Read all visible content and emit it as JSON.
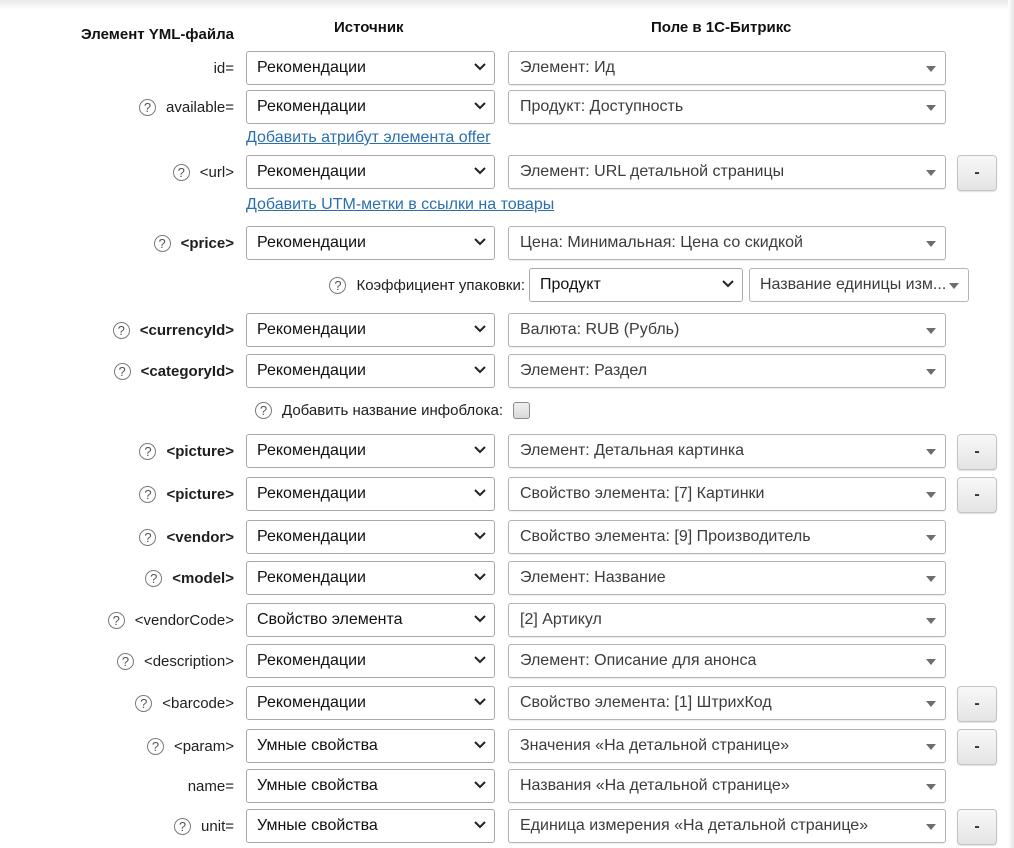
{
  "headers": {
    "element": "Элемент YML-файла",
    "source": "Источник",
    "field": "Поле в 1С-Битрикс"
  },
  "links": {
    "add_offer_attr": "Добавить атрибут элемента offer",
    "add_utm": "Добавить UTM-метки в ссылки на товары"
  },
  "pack": {
    "label": "Коэффициент упаковки:",
    "source": "Продукт",
    "field": "Название единицы изм..."
  },
  "infoblock": {
    "label": "Добавить название инфоблока:",
    "checked": false
  },
  "rows": [
    {
      "label": "id=",
      "source": "Рекомендации",
      "field": "Элемент: Ид"
    },
    {
      "label": "available=",
      "source": "Рекомендации",
      "field": "Продукт: Доступность"
    },
    {
      "label": "<url>",
      "source": "Рекомендации",
      "field": "Элемент: URL детальной страницы"
    },
    {
      "label": "<price>",
      "source": "Рекомендации",
      "field": "Цена: Минимальная: Цена со скидкой"
    },
    {
      "label": "<currencyId>",
      "source": "Рекомендации",
      "field": "Валюта: RUB (Рубль)"
    },
    {
      "label": "<categoryId>",
      "source": "Рекомендации",
      "field": "Элемент: Раздел"
    },
    {
      "label": "<picture>",
      "source": "Рекомендации",
      "field": "Элемент: Детальная картинка"
    },
    {
      "label": "<picture>",
      "source": "Рекомендации",
      "field": "Свойство элемента: [7] Картинки"
    },
    {
      "label": "<vendor>",
      "source": "Рекомендации",
      "field": "Свойство элемента: [9] Производитель"
    },
    {
      "label": "<model>",
      "source": "Рекомендации",
      "field": "Элемент: Название"
    },
    {
      "label": "<vendorCode>",
      "source": "Свойство элемента",
      "field": "[2] Артикул"
    },
    {
      "label": "<description>",
      "source": "Рекомендации",
      "field": "Элемент: Описание для анонса"
    },
    {
      "label": "<barcode>",
      "source": "Рекомендации",
      "field": "Свойство элемента: [1] ШтрихКод"
    },
    {
      "label": "<param>",
      "source": "Умные свойства",
      "field": "Значения «На детальной странице»"
    },
    {
      "label": "name=",
      "source": "Умные свойства",
      "field": "Названия «На детальной странице»"
    },
    {
      "label": "unit=",
      "source": "Умные свойства",
      "field": "Единица измерения «На детальной странице»"
    }
  ],
  "help_glyph": "?",
  "remove_glyph": "-"
}
